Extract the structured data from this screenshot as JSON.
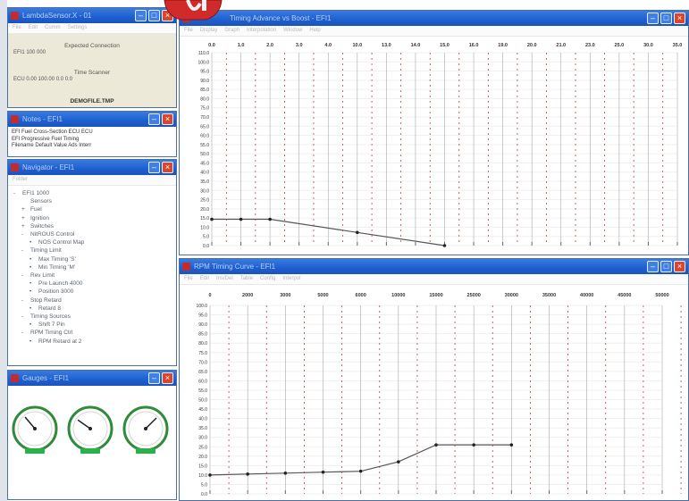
{
  "windows": {
    "connection": {
      "title": "LambdaSensor.X - 01",
      "menu": [
        "File",
        "Edit",
        "Comm",
        "Settings"
      ],
      "heading": "Expected Connection",
      "line1": "EFI1 100 000",
      "subheading": "Time Scanner",
      "line2": "ECU 0.00  100.00 0.0 0.0",
      "status": "DEMOFILE.TMP"
    },
    "notes": {
      "title": "Notes - EFI1",
      "lines": [
        "EFI Fuel   Cross-Section ECU ECU",
        "EFI Progressive Fuel Timing",
        "Filename Default Value Ads Interr"
      ]
    },
    "navigator": {
      "title": "Navigator - EFI1",
      "menu": [
        "Folder"
      ],
      "items": [
        {
          "indent": 0,
          "marker": "-",
          "label": "EFI1 1000"
        },
        {
          "indent": 1,
          "marker": "",
          "label": "Sensors"
        },
        {
          "indent": 1,
          "marker": "+",
          "label": "Fuel"
        },
        {
          "indent": 1,
          "marker": "+",
          "label": "Ignition"
        },
        {
          "indent": 1,
          "marker": "+",
          "label": "Switches"
        },
        {
          "indent": 1,
          "marker": "-",
          "label": "NitROUS Control"
        },
        {
          "indent": 2,
          "marker": "•",
          "label": "NOS Control Map"
        },
        {
          "indent": 1,
          "marker": "-",
          "label": "Timing Limit"
        },
        {
          "indent": 2,
          "marker": "•",
          "label": "Max Timing 'S'"
        },
        {
          "indent": 2,
          "marker": "•",
          "label": "Min Timing 'M'"
        },
        {
          "indent": 1,
          "marker": "-",
          "label": "Rev Limit"
        },
        {
          "indent": 2,
          "marker": "•",
          "label": "Pre Launch 4000"
        },
        {
          "indent": 2,
          "marker": "•",
          "label": "Position 3000"
        },
        {
          "indent": 1,
          "marker": "-",
          "label": "Stop Retard"
        },
        {
          "indent": 2,
          "marker": "•",
          "label": "Retard 8"
        },
        {
          "indent": 1,
          "marker": "-",
          "label": "Timing Sources"
        },
        {
          "indent": 2,
          "marker": "•",
          "label": "Shift 7 Pin"
        },
        {
          "indent": 1,
          "marker": "-",
          "label": "RPM Timing Ctrl"
        },
        {
          "indent": 2,
          "marker": "•",
          "label": "RPM Retard at 2"
        }
      ]
    },
    "gauges": {
      "title": "Gauges - EFI1",
      "gauges": [
        {
          "name": "gauge-1",
          "needle_angle": -40,
          "color": "#2f8a3a"
        },
        {
          "name": "gauge-2",
          "needle_angle": -55,
          "color": "#2f8a3a"
        },
        {
          "name": "gauge-3",
          "needle_angle": 45,
          "color": "#2f8a3a"
        }
      ]
    },
    "top_chart": {
      "title": "Timing Advance vs Boost - EFI1",
      "menu": [
        "File",
        "Display",
        "Graph",
        "Interpolation",
        "Window",
        "Help"
      ]
    },
    "bottom_chart": {
      "title": "RPM Timing Curve - EFI1",
      "menu": [
        "File",
        "Edit",
        "Ins/Del",
        "Table",
        "Config",
        "Interpol"
      ]
    }
  },
  "colors": {
    "titlebar": "#1d5fd0",
    "close": "#d9462e",
    "grid_dash": "#c23a3a",
    "grid_line": "#a8a8a8",
    "curve": "#555555",
    "logo": "#d02a2a"
  },
  "chart_data": [
    {
      "type": "line",
      "x_ticks": [
        "0.0",
        "1.0",
        "2.0",
        "3.0",
        "4.0",
        "10.0",
        "13.0",
        "14.0",
        "15.0",
        "16.0",
        "19.0",
        "20.0",
        "21.0",
        "23.0",
        "25.0",
        "30.0",
        "35.0"
      ],
      "y_ticks": [
        "110.0",
        "100.0",
        "95.0",
        "90.0",
        "85.0",
        "80.0",
        "75.0",
        "70.0",
        "65.0",
        "60.0",
        "55.0",
        "50.0",
        "45.0",
        "40.0",
        "35.0",
        "30.0",
        "25.0",
        "20.0",
        "15.0",
        "10.0",
        "5.0",
        "0.0"
      ],
      "x": [
        0,
        1,
        2,
        5,
        8
      ],
      "y": [
        15.0,
        15.0,
        15.0,
        7.5,
        0.0
      ],
      "ylim": [
        0,
        110
      ],
      "grid": true
    },
    {
      "type": "line",
      "x_ticks": [
        "0",
        "2000",
        "3000",
        "5000",
        "6000",
        "10000",
        "15000",
        "25000",
        "30000",
        "35000",
        "40000",
        "45000",
        "50000"
      ],
      "y_ticks": [
        "100.0",
        "95.0",
        "90.0",
        "85.0",
        "80.0",
        "75.0",
        "70.0",
        "65.0",
        "60.0",
        "55.0",
        "50.0",
        "45.0",
        "40.0",
        "35.0",
        "30.0",
        "25.0",
        "20.0",
        "15.0",
        "10.0",
        "5.0",
        "0.0"
      ],
      "x": [
        0,
        1,
        2,
        3,
        4,
        5,
        6,
        7,
        8
      ],
      "y": [
        10.0,
        10.5,
        11.0,
        11.5,
        12.0,
        17.0,
        26.0,
        26.0,
        26.0
      ],
      "ylim": [
        0,
        100
      ],
      "grid": true
    }
  ]
}
